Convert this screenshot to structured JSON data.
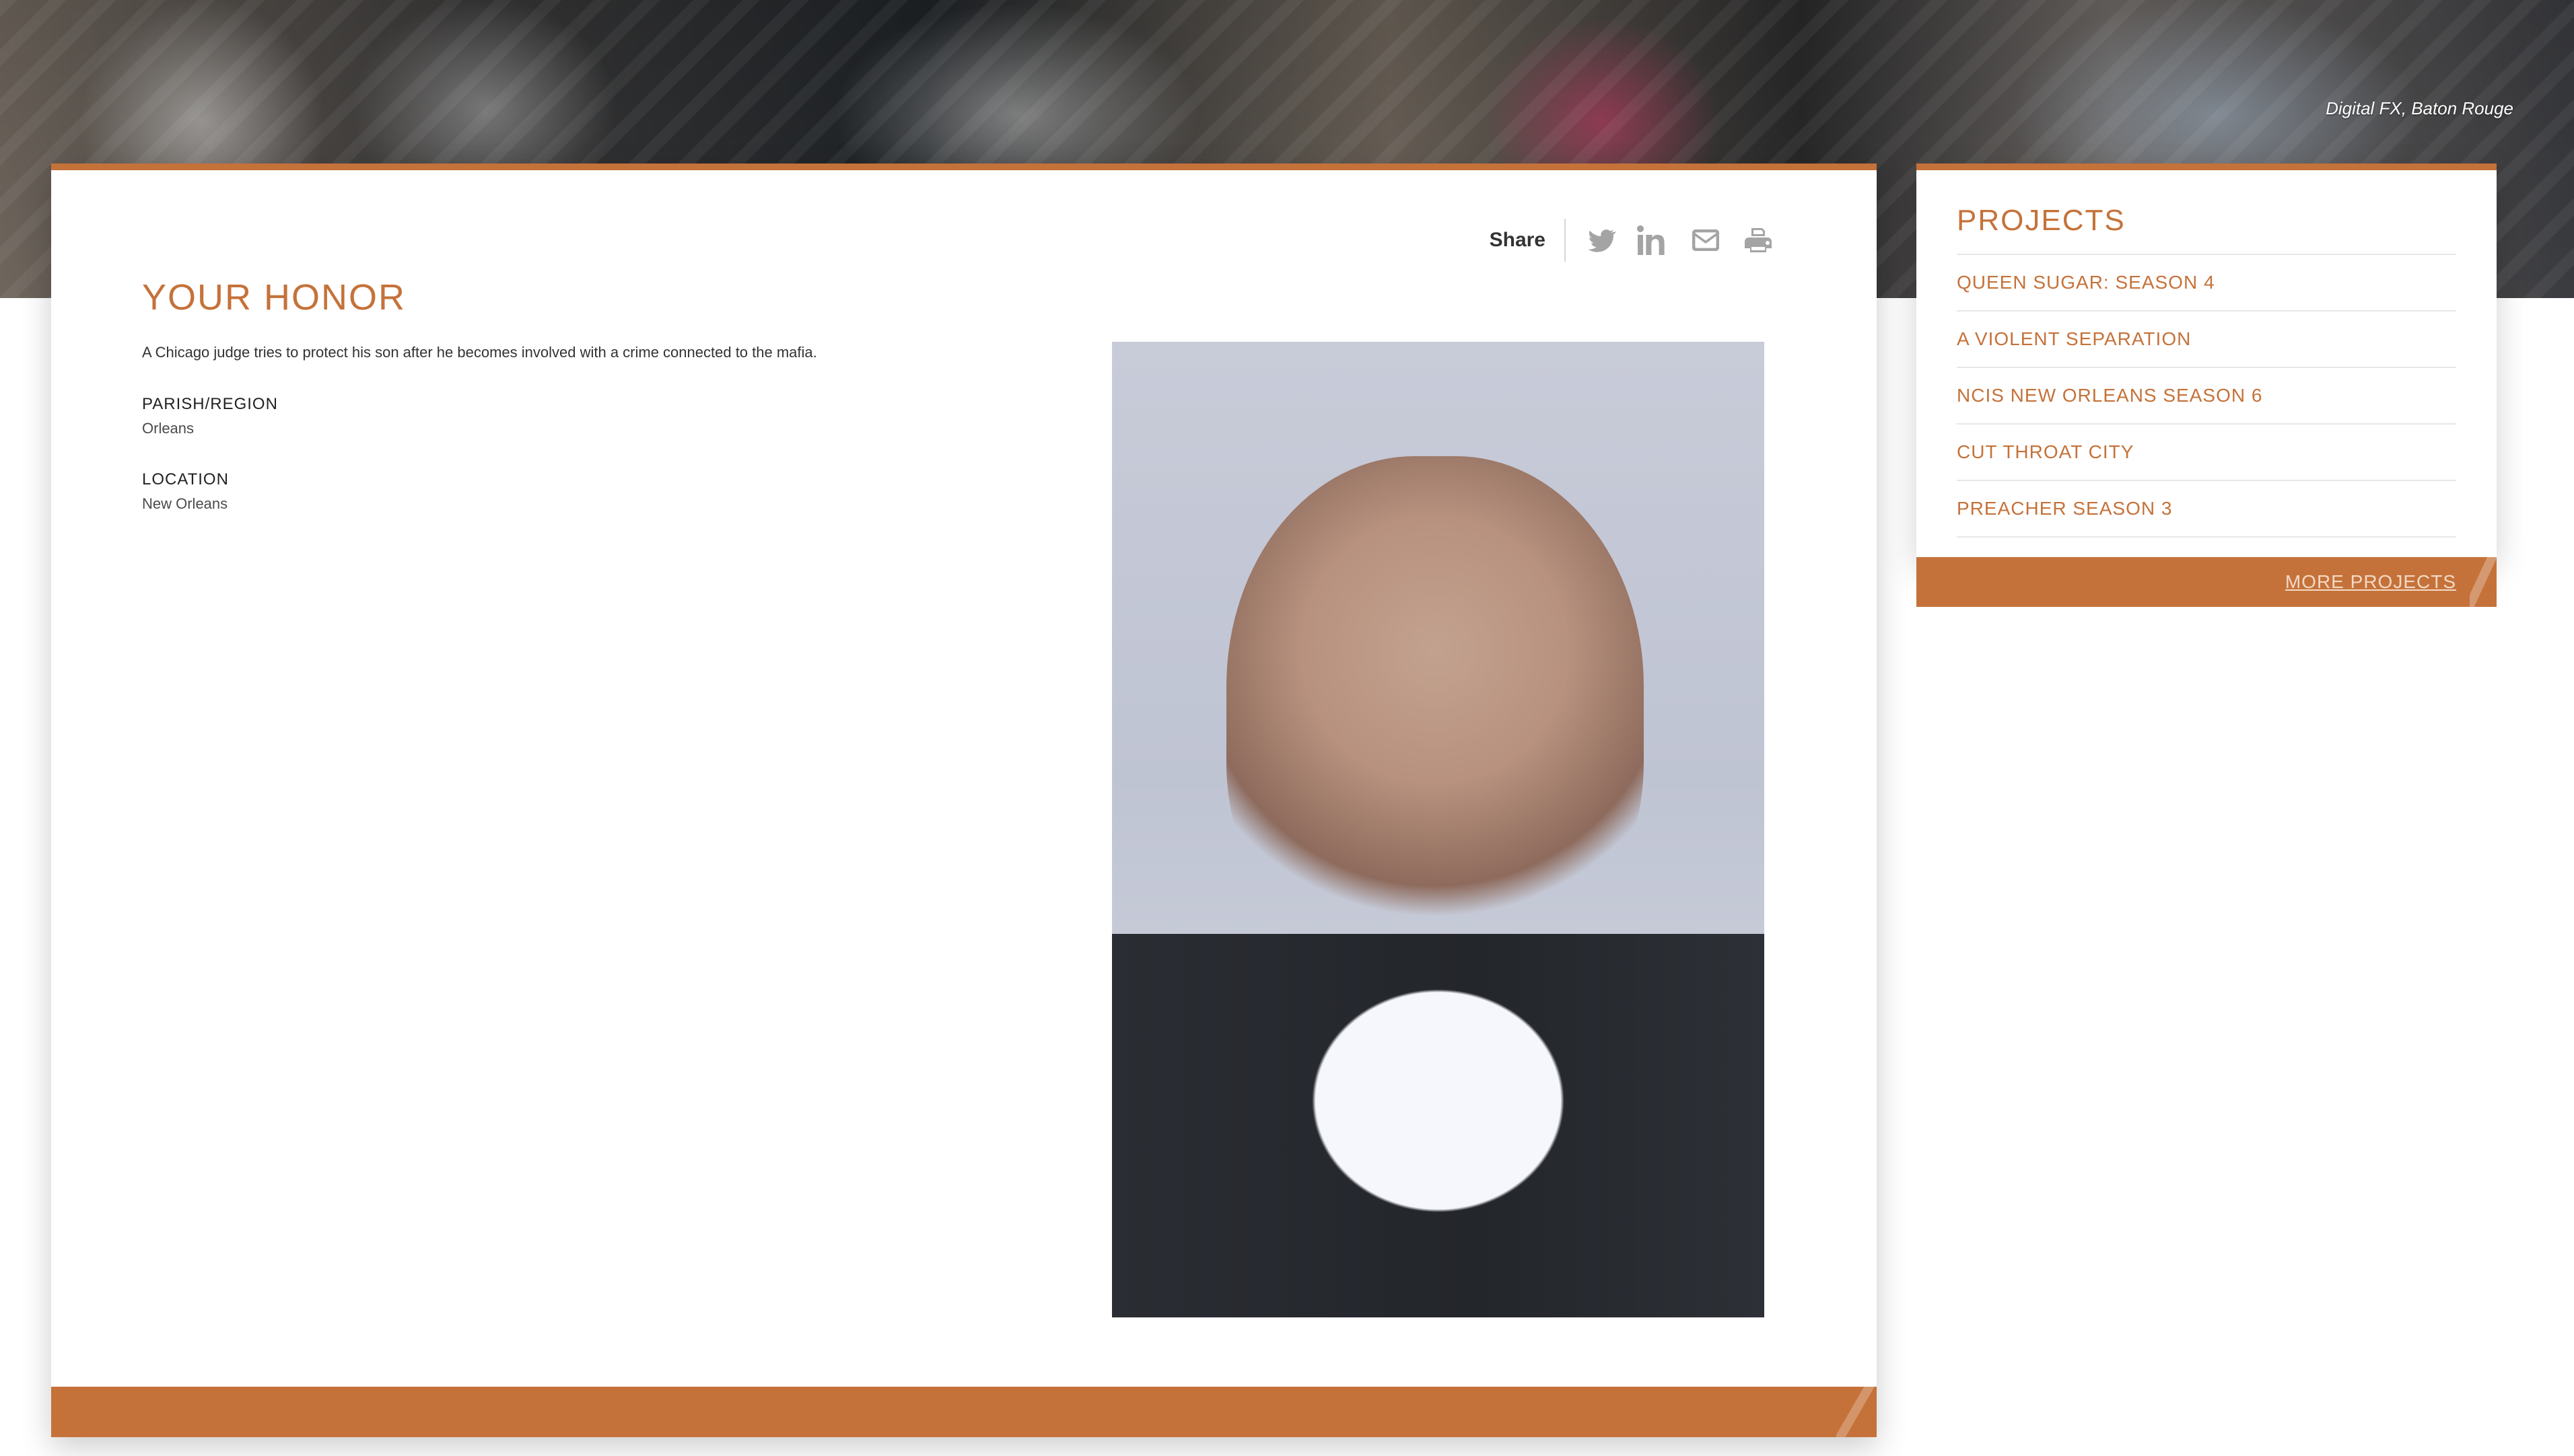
{
  "hero": {
    "caption": "Digital FX, Baton Rouge"
  },
  "share": {
    "label": "Share",
    "icons": [
      "twitter-icon",
      "linkedin-icon",
      "mail-icon",
      "print-icon"
    ]
  },
  "project": {
    "title": "YOUR HONOR",
    "description": "A Chicago judge tries to protect his son after he becomes involved with a crime connected to the mafia.",
    "parish_label": "PARISH/REGION",
    "parish_value": "Orleans",
    "location_label": "LOCATION",
    "location_value": "New Orleans"
  },
  "sidebar": {
    "title": "PROJECTS",
    "items": [
      {
        "label": "QUEEN SUGAR: SEASON 4"
      },
      {
        "label": "A VIOLENT SEPARATION"
      },
      {
        "label": "NCIS NEW ORLEANS SEASON 6"
      },
      {
        "label": "CUT THROAT CITY"
      },
      {
        "label": "PREACHER SEASON 3"
      }
    ],
    "more_label": "MORE PROJECTS"
  },
  "colors": {
    "accent": "#c5723a",
    "rule": "#e7e7e7"
  }
}
